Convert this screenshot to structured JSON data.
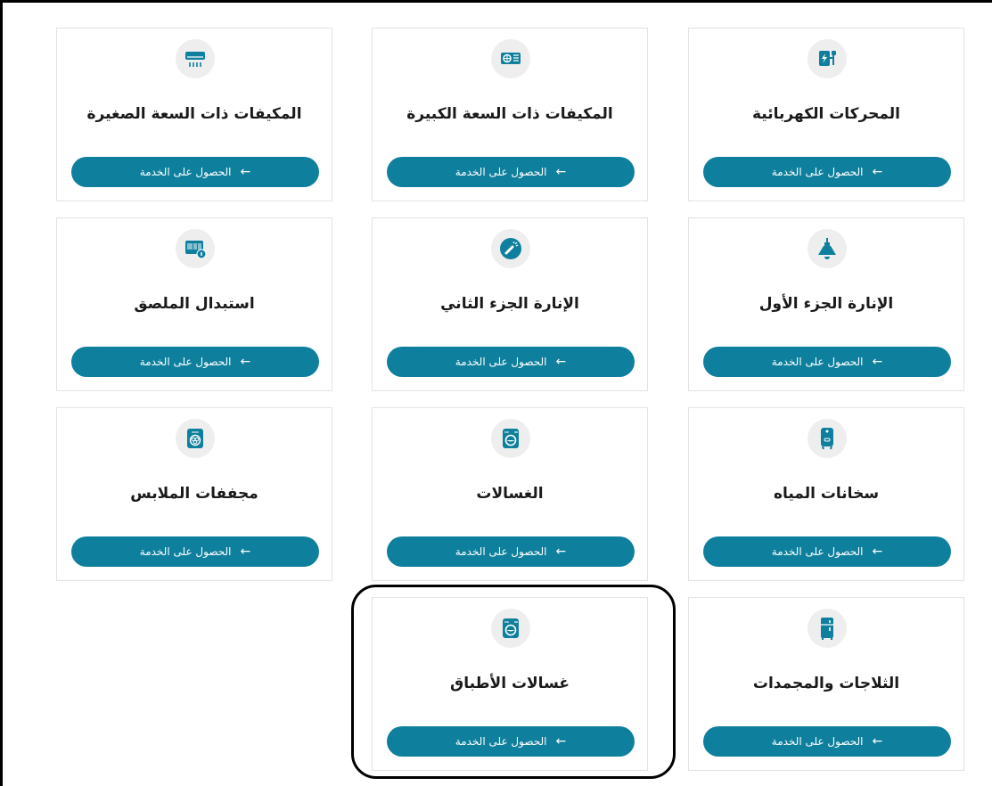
{
  "brand_color": "#0e7f9c",
  "cards": [
    {
      "title": "المحركات الكهربائية",
      "button_label": "الحصول على الخدمة",
      "icon": "plug-icon"
    },
    {
      "title": "المكيفات ذات السعة الكبيرة",
      "button_label": "الحصول على الخدمة",
      "icon": "ac-unit-icon"
    },
    {
      "title": "المكيفات ذات السعة الصغيرة",
      "button_label": "الحصول على الخدمة",
      "icon": "split-ac-icon"
    },
    {
      "title": "الإنارة الجزء الأول",
      "button_label": "الحصول على الخدمة",
      "icon": "ceiling-lamp-icon"
    },
    {
      "title": "الإنارة الجزء الثاني",
      "button_label": "الحصول على الخدمة",
      "icon": "flashlight-icon"
    },
    {
      "title": "استبدال الملصق",
      "button_label": "الحصول على الخدمة",
      "icon": "label-barcode-icon"
    },
    {
      "title": "سخانات المياه",
      "button_label": "الحصول على الخدمة",
      "icon": "water-heater-icon"
    },
    {
      "title": "الغسالات",
      "button_label": "الحصول على الخدمة",
      "icon": "washing-machine-icon"
    },
    {
      "title": "مجففات الملابس",
      "button_label": "الحصول على الخدمة",
      "icon": "clothes-dryer-icon"
    },
    {
      "title": "الثلاجات والمجمدات",
      "button_label": "الحصول على الخدمة",
      "icon": "refrigerator-icon"
    },
    {
      "title": "غسالات الأطباق",
      "button_label": "الحصول على الخدمة",
      "icon": "dishwasher-icon"
    }
  ]
}
